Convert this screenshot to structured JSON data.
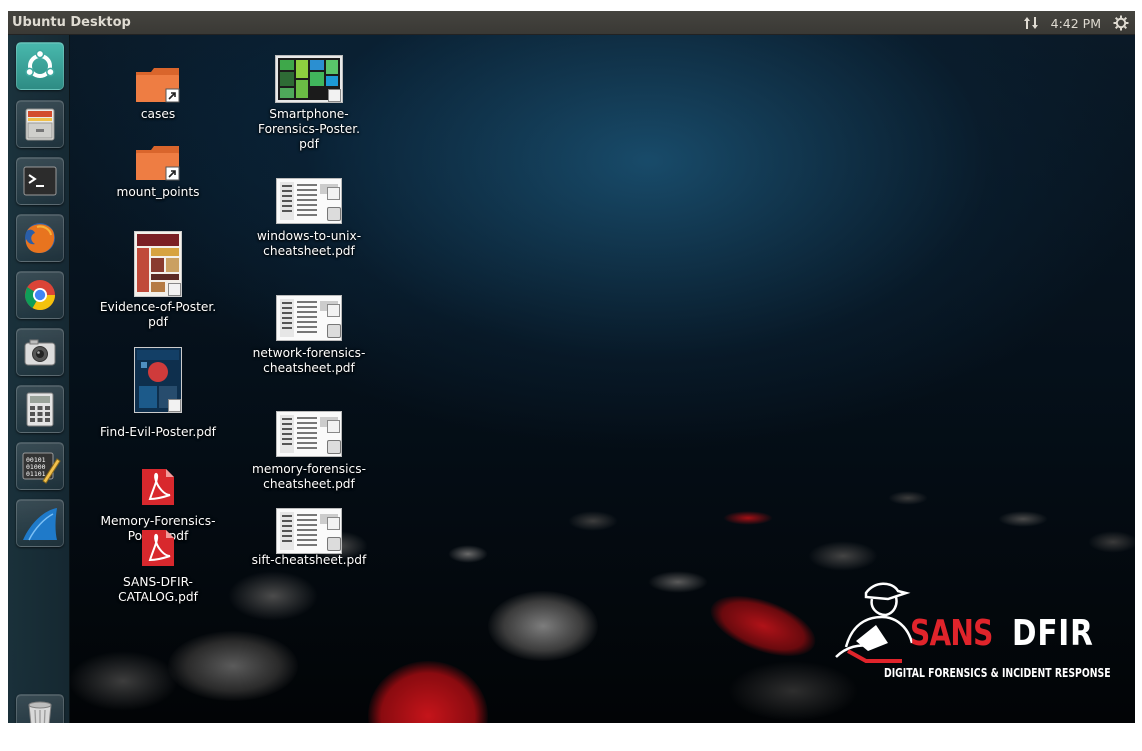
{
  "panel": {
    "title": "Ubuntu Desktop",
    "clock": "4:42 PM",
    "icons": [
      "network-updown-icon",
      "power-settings-icon"
    ]
  },
  "launcher": {
    "items": [
      {
        "name": "dash-home",
        "icon": "ubuntu-logo-icon"
      },
      {
        "name": "files",
        "icon": "file-cabinet-icon"
      },
      {
        "name": "terminal",
        "icon": "terminal-icon"
      },
      {
        "name": "firefox",
        "icon": "firefox-icon"
      },
      {
        "name": "chrome",
        "icon": "chrome-icon"
      },
      {
        "name": "camera",
        "icon": "camera-icon"
      },
      {
        "name": "calculator",
        "icon": "calculator-icon"
      },
      {
        "name": "hex-editor",
        "icon": "binary-editor-icon"
      },
      {
        "name": "wireshark",
        "icon": "wireshark-fin-icon"
      },
      {
        "name": "trash",
        "icon": "trash-icon"
      }
    ]
  },
  "desktop": {
    "icons": [
      {
        "label": "cases",
        "type": "folder-shortcut"
      },
      {
        "label": "mount_points",
        "type": "folder-shortcut"
      },
      {
        "label": "Evidence-of-Poster.\npdf",
        "type": "pdf-poster"
      },
      {
        "label": "Find-Evil-Poster.pdf",
        "type": "pdf-poster"
      },
      {
        "label": "Memory-Forensics-\nPoster.pdf",
        "type": "pdf-acrobat"
      },
      {
        "label": "SANS-DFIR-\nCATALOG.pdf",
        "type": "pdf-acrobat"
      },
      {
        "label": "Smartphone-\nForensics-Poster.\npdf",
        "type": "pdf-poster"
      },
      {
        "label": "windows-to-unix-\ncheatsheet.pdf",
        "type": "pdf-cheatsheet"
      },
      {
        "label": "network-forensics-\ncheatsheet.pdf",
        "type": "pdf-cheatsheet"
      },
      {
        "label": "memory-forensics-\ncheatsheet.pdf",
        "type": "pdf-cheatsheet"
      },
      {
        "label": "sift-cheatsheet.pdf",
        "type": "pdf-cheatsheet"
      }
    ]
  },
  "logo": {
    "sans": "SANS",
    "dfir": "DFIR",
    "tagline": "DIGITAL FORENSICS & INCIDENT RESPONSE"
  },
  "colors": {
    "panel": "#3c3b37",
    "panel_text": "#dfdbd2",
    "folder": "#e8773c",
    "sans_red": "#e0242b",
    "launcher_ubuntu": "#3fa9a0"
  }
}
